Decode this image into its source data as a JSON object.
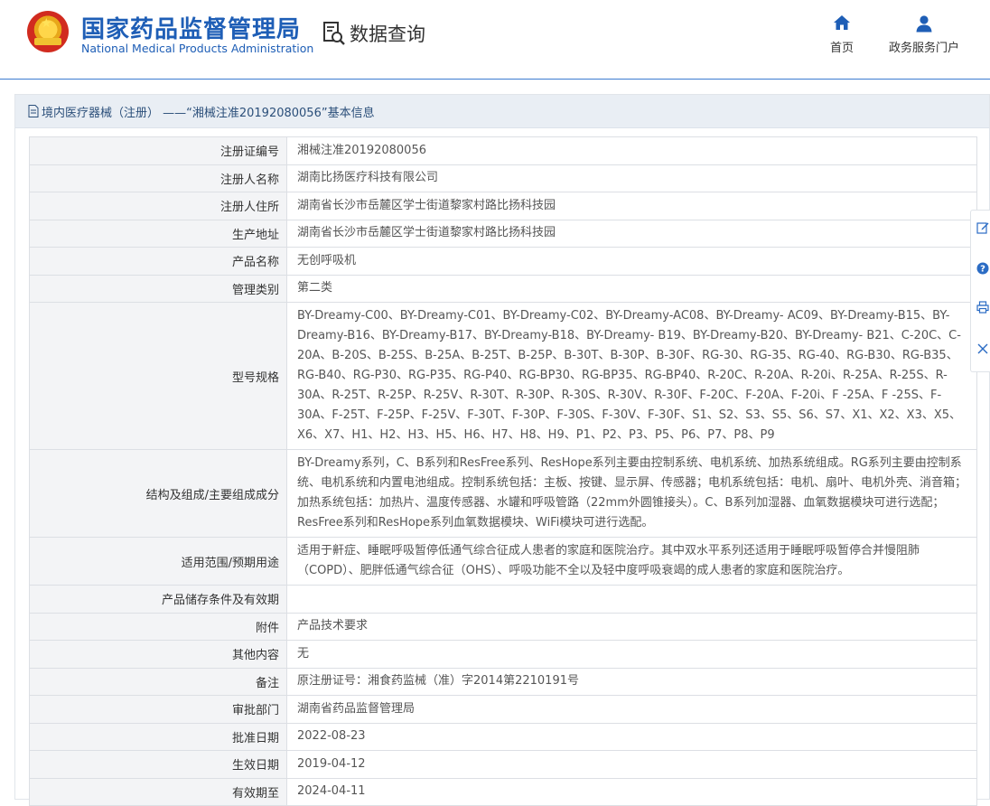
{
  "header": {
    "org_name_cn": "国家药品监督管理局",
    "org_name_en": "National Medical Products Administration",
    "query_label": "数据查询",
    "nav": [
      {
        "label": "首页",
        "icon": "home-icon"
      },
      {
        "label": "政务服务门户",
        "icon": "user-icon"
      }
    ]
  },
  "colors": {
    "brand_blue": "#1e5eb6",
    "title_bar": "#e9eef4",
    "label_bg": "#f3f4f6"
  },
  "panel": {
    "title": "境内医疗器械（注册） ——“湘械注准20192080056”基本信息"
  },
  "rows": [
    {
      "label": "注册证编号",
      "value": "湘械注准20192080056"
    },
    {
      "label": "注册人名称",
      "value": "湖南比扬医疗科技有限公司"
    },
    {
      "label": "注册人住所",
      "value": "湖南省长沙市岳麓区学士街道黎家村路比扬科技园"
    },
    {
      "label": "生产地址",
      "value": "湖南省长沙市岳麓区学士街道黎家村路比扬科技园"
    },
    {
      "label": "产品名称",
      "value": "无创呼吸机"
    },
    {
      "label": "管理类别",
      "value": "第二类"
    },
    {
      "label": "型号规格",
      "value": "BY-Dreamy-C00、BY-Dreamy-C01、BY-Dreamy-C02、BY-Dreamy-AC08、BY-Dreamy- AC09、BY-Dreamy-B15、BY-Dreamy-B16、BY-Dreamy-B17、BY-Dreamy-B18、BY-Dreamy- B19、BY-Dreamy-B20、BY-Dreamy- B21、C-20C、C-20A、B-20S、B-25S、B-25A、B-25T、B-25P、B-30T、B-30P、B-30F、RG-30、RG-35、RG-40、RG-B30、RG-B35、RG-B40、RG-P30、RG-P35、RG-P40、RG-BP30、RG-BP35、RG-BP40、R-20C、R-20A、R-20i、R-25A、R-25S、R-30A、R-25T、R-25P、R-25V、R-30T、R-30P、R-30S、R-30V、R-30F、F-20C、F-20A、F-20i、F -25A、F -25S、F-30A、F-25T、F-25P、F-25V、F-30T、F-30P、F-30S、F-30V、F-30F、S1、S2、S3、S5、S6、S7、X1、X2、X3、X5、X6、X7、H1、H2、H3、H5、H6、H7、H8、H9、P1、P2、P3、P5、P6、P7、P8、P9"
    },
    {
      "label": "结构及组成/主要组成成分",
      "value": "BY-Dreamy系列，C、B系列和ResFree系列、ResHope系列主要由控制系统、电机系统、加热系统组成。RG系列主要由控制系统、电机系统和内置电池组成。控制系统包括：主板、按键、显示屏、传感器；电机系统包括：电机、扇叶、电机外壳、消音箱；加热系统包括：加热片、温度传感器、水罐和呼吸管路（22mm外圆锥接头）。C、B系列加湿器、血氧数据模块可进行选配；ResFree系列和ResHope系列血氧数据模块、WiFi模块可进行选配。"
    },
    {
      "label": "适用范围/预期用途",
      "value": "适用于鼾症、睡眠呼吸暂停低通气综合征成人患者的家庭和医院治疗。其中双水平系列还适用于睡眠呼吸暂停合并慢阻肺（COPD）、肥胖低通气综合征（OHS）、呼吸功能不全以及轻中度呼吸衰竭的成人患者的家庭和医院治疗。"
    },
    {
      "label": "产品储存条件及有效期",
      "value": ""
    },
    {
      "label": "附件",
      "value": "产品技术要求"
    },
    {
      "label": "其他内容",
      "value": "无"
    },
    {
      "label": "备注",
      "value": "原注册证号：湘食药监械（准）字2014第2210191号"
    },
    {
      "label": "审批部门",
      "value": "湖南省药品监督管理局"
    },
    {
      "label": "批准日期",
      "value": "2022-08-23"
    },
    {
      "label": "生效日期",
      "value": "2019-04-12"
    },
    {
      "label": "有效期至",
      "value": "2024-04-11"
    }
  ],
  "float_toolbar": [
    "edit-icon",
    "help-icon",
    "print-icon",
    "close-icon"
  ]
}
